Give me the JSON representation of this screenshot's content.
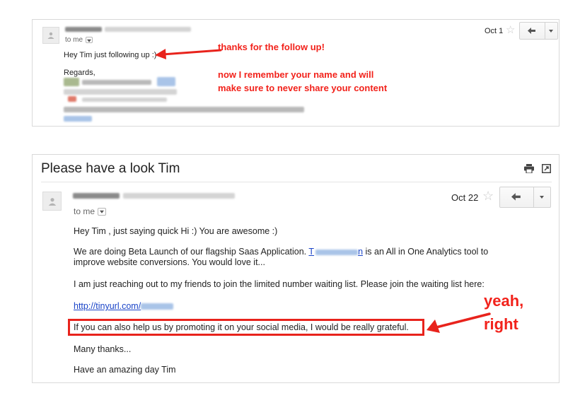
{
  "email_top": {
    "recipient": "to me",
    "date": "Oct 1",
    "body_line": "Hey Tim just following up :)",
    "signoff": "Regards,"
  },
  "email_bottom": {
    "subject": "Please have a look Tim",
    "recipient": "to me",
    "date": "Oct 22",
    "greeting": "Hey Tim , just saying quick Hi :) You are awesome :)",
    "para1_a": "We are doing Beta Launch of our flagship Saas Application.",
    "para1_link_start": "T",
    "para1_b": "is an All in One Analytics tool to",
    "para1_c": "improve website conversions. You would love it...",
    "para2": "I am just reaching out to my friends to join the limited number waiting list. Please join the waiting list here:",
    "link_text": "http://tinyurl.com/",
    "highlighted": "If you can also help us by promoting it on your social media, I would be really grateful.",
    "thanks": "Many thanks...",
    "closing": "Have an amazing day Tim"
  },
  "annotations": {
    "top_line1": "thanks for the follow up!",
    "top_line2": "now I remember your name and will",
    "top_line3": "make sure to never share your content",
    "bottom_line1": "yeah,",
    "bottom_line2": "right"
  },
  "icons": {
    "avatar": "person-icon",
    "star": "star-icon",
    "reply": "reply-arrow-icon",
    "more": "dropdown-arrow-icon",
    "print": "print-icon",
    "new_window": "new-window-icon"
  },
  "colors": {
    "annotation": "#f2221b",
    "link": "#1a44c8"
  }
}
